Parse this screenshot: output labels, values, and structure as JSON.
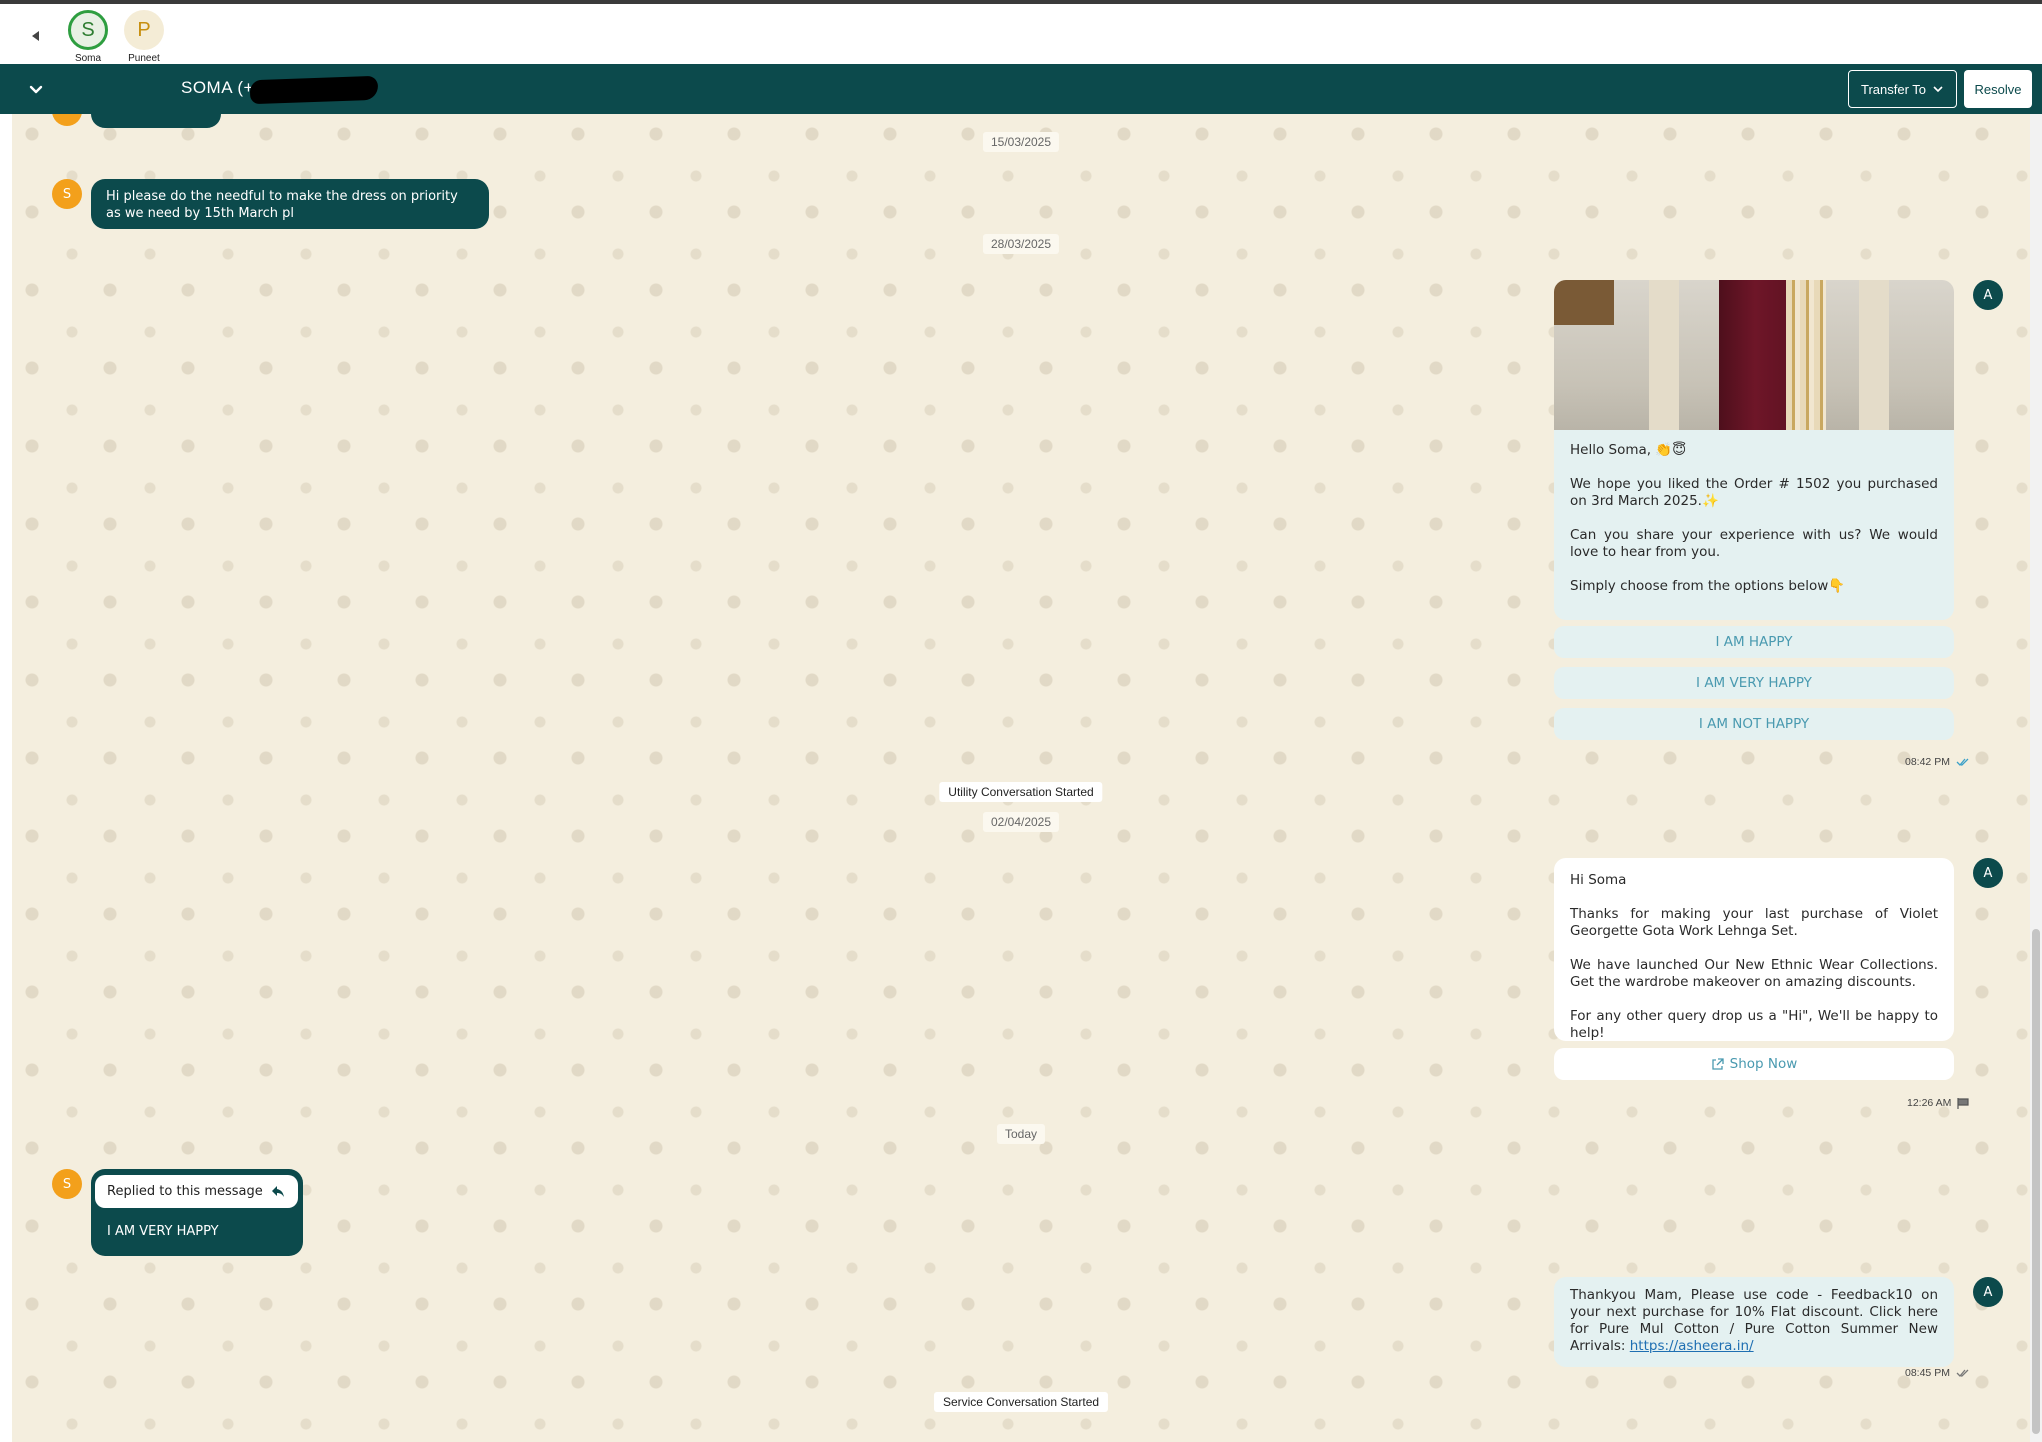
{
  "tabs": {
    "back_icon": "caret-left-icon",
    "contacts": [
      {
        "initial": "S",
        "name": "Soma",
        "active": true
      },
      {
        "initial": "P",
        "name": "Puneet",
        "active": false
      }
    ]
  },
  "header": {
    "collapse_icon": "chevron-down-icon",
    "title": "SOMA (+",
    "transfer_label": "Transfer To",
    "resolve_label": "Resolve",
    "bg_color": "#0c4a4c"
  },
  "conversation": {
    "dates": [
      "15/03/2025",
      "28/03/2025",
      "02/04/2025",
      "Today"
    ],
    "system_events": [
      "Utility Conversation Started",
      "Service Conversation Started"
    ],
    "msg1": {
      "sender_initial": "S",
      "text": "Hi please do the needful to make the dress on priority as we need by 15th March pl"
    },
    "template1": {
      "agent_initial": "A",
      "greeting": "Hello Soma, 👏😇",
      "p1": "We hope you liked the Order # 1502 you purchased on 3rd March 2025.✨",
      "p2": "Can you share your experience with us? We would love to hear from you.",
      "p3": "Simply choose from the options below👇",
      "buttons": [
        "I AM HAPPY",
        "I AM VERY HAPPY",
        "I AM NOT HAPPY"
      ],
      "time": "08:42 PM",
      "status_icon": "double-check-icon"
    },
    "template2": {
      "agent_initial": "A",
      "p1": "Hi Soma",
      "p2": "Thanks for making your last purchase of Violet Georgette Gota Work Lehnga Set.",
      "p3": "We have launched Our New Ethnic Wear Collections. Get the wardrobe makeover on amazing discounts.",
      "p4": "For any other query drop us a \"Hi\", We'll be happy to help!",
      "cta_label": "Shop Now",
      "time": "12:26 AM",
      "status_icon": "flag-icon"
    },
    "reply": {
      "sender_initial": "S",
      "quote_label": "Replied to this message",
      "text": "I AM VERY HAPPY"
    },
    "msg_last": {
      "agent_initial": "A",
      "text": "Thankyou Mam, Please use code - Feedback10 on your next purchase for 10% Flat discount. Click here for Pure Mul Cotton / Pure Cotton Summer New Arrivals: ",
      "link": "https://asheera.in/",
      "time": "08:45 PM",
      "status_icon": "double-check-icon"
    }
  }
}
